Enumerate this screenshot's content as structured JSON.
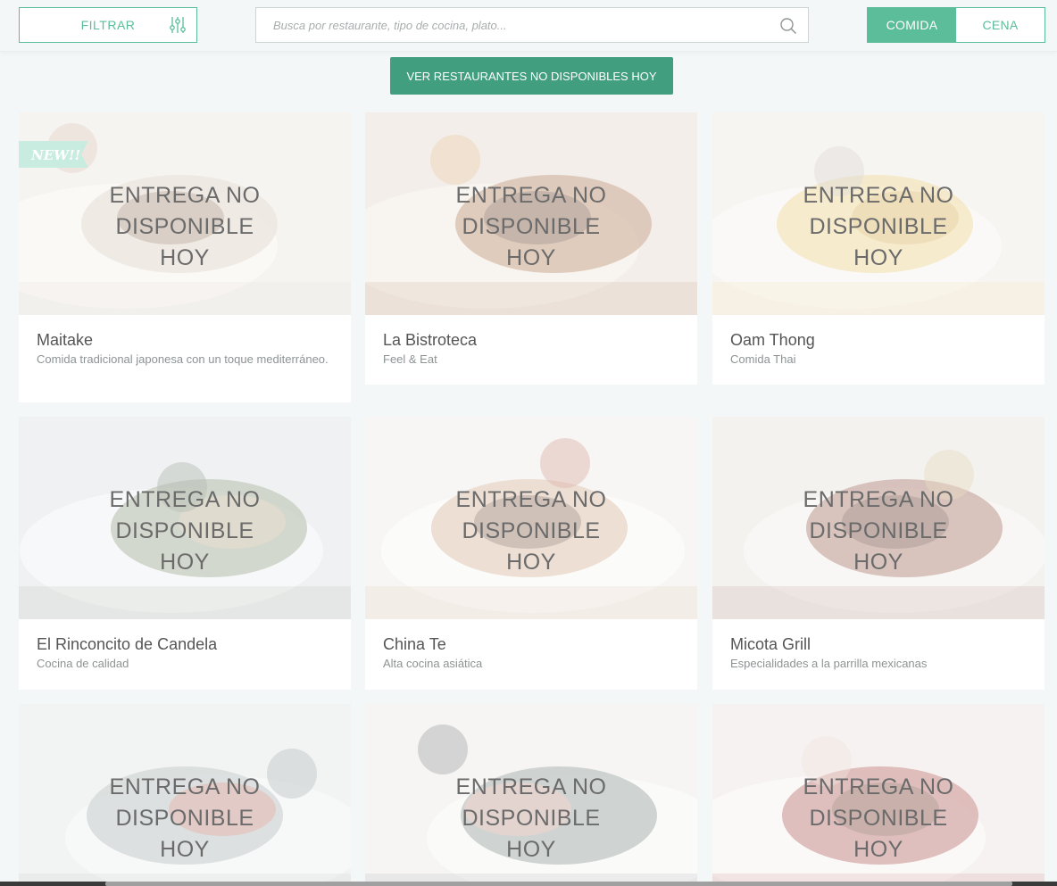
{
  "header": {
    "filter_label": "FILTRAR",
    "search_placeholder": "Busca por restaurante, tipo de cocina, plato...",
    "meal_options": [
      "COMIDA",
      "CENA"
    ],
    "meal_selected": "COMIDA"
  },
  "unavailable_button_label": "VER RESTAURANTES NO DISPONIBLES HOY",
  "new_badge": "NEW!!",
  "restaurants": [
    {
      "name": "Maitake",
      "description": "Comida tradicional japonesa con un toque mediterráneo.",
      "status": "ENTREGA NO DISPONIBLE HOY",
      "is_new": true
    },
    {
      "name": "La Bistroteca",
      "description": "Feel & Eat",
      "status": "ENTREGA NO DISPONIBLE HOY",
      "is_new": false
    },
    {
      "name": "Oam Thong",
      "description": "Comida Thai",
      "status": "ENTREGA NO DISPONIBLE HOY",
      "is_new": false
    },
    {
      "name": "El Rinconcito de Candela",
      "description": "Cocina de calidad",
      "status": "ENTREGA NO DISPONIBLE HOY",
      "is_new": false
    },
    {
      "name": "China Te",
      "description": "Alta cocina asiática",
      "status": "ENTREGA NO DISPONIBLE HOY",
      "is_new": false
    },
    {
      "name": "Micota Grill",
      "description": "Especialidades a la parrilla mexicanas",
      "status": "ENTREGA NO DISPONIBLE HOY",
      "is_new": false
    },
    {
      "name": "",
      "description": "",
      "status": "ENTREGA NO DISPONIBLE HOY",
      "is_new": false
    },
    {
      "name": "",
      "description": "",
      "status": "ENTREGA NO DISPONIBLE HOY",
      "is_new": false
    },
    {
      "name": "",
      "description": "",
      "status": "ENTREGA NO DISPONIBLE HOY",
      "is_new": false
    }
  ],
  "colors": {
    "accent": "#5bbd9a",
    "button_dark": "#419e7f",
    "page_bg": "#f3f7f7"
  },
  "icons": {
    "filter": "sliders-icon",
    "search": "search-icon"
  }
}
